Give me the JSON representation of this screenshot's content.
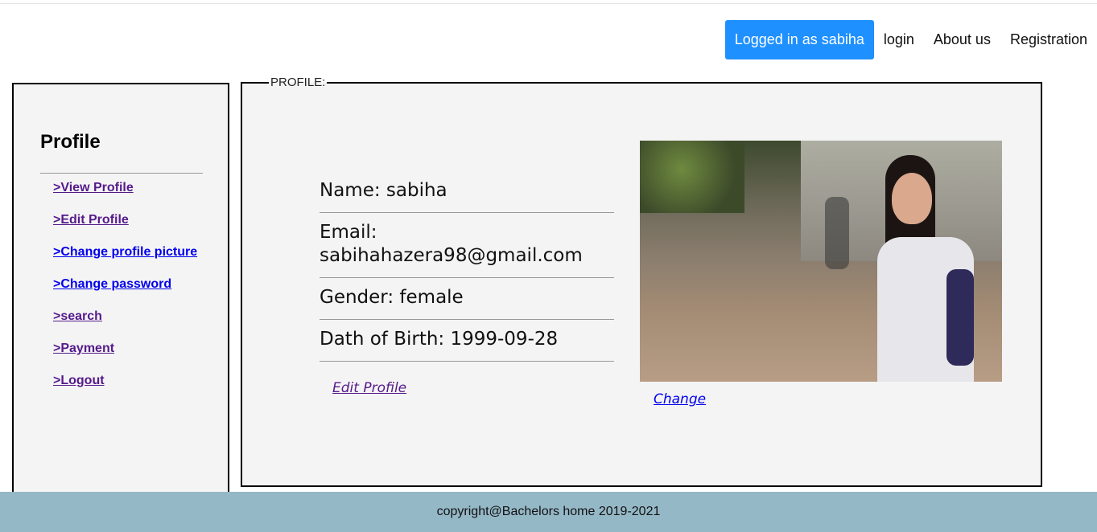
{
  "nav": {
    "logged_in": "Logged in as sabiha",
    "login": "login",
    "about": "About us",
    "registration": "Registration"
  },
  "sidebar": {
    "title": "Profile",
    "items": [
      {
        "label": ">View Profile"
      },
      {
        "label": ">Edit Profile"
      },
      {
        "label": ">Change profile picture"
      },
      {
        "label": ">Change password"
      },
      {
        "label": ">search"
      },
      {
        "label": ">Payment"
      },
      {
        "label": ">Logout"
      }
    ]
  },
  "profile": {
    "legend": "PROFILE:",
    "name": "Name: sabiha",
    "email": "Email: sabihahazera98@gmail.com",
    "gender": "Gender: female",
    "dob": "Dath of Birth: 1999-09-28",
    "edit_link": "Edit Profile",
    "change_link": "Change"
  },
  "footer": {
    "text": "copyright@Bachelors home 2019-2021"
  },
  "colors": {
    "accent": "#1e90ff",
    "footer_bg": "#95b8c7",
    "panel_bg": "#f4f4f4"
  }
}
